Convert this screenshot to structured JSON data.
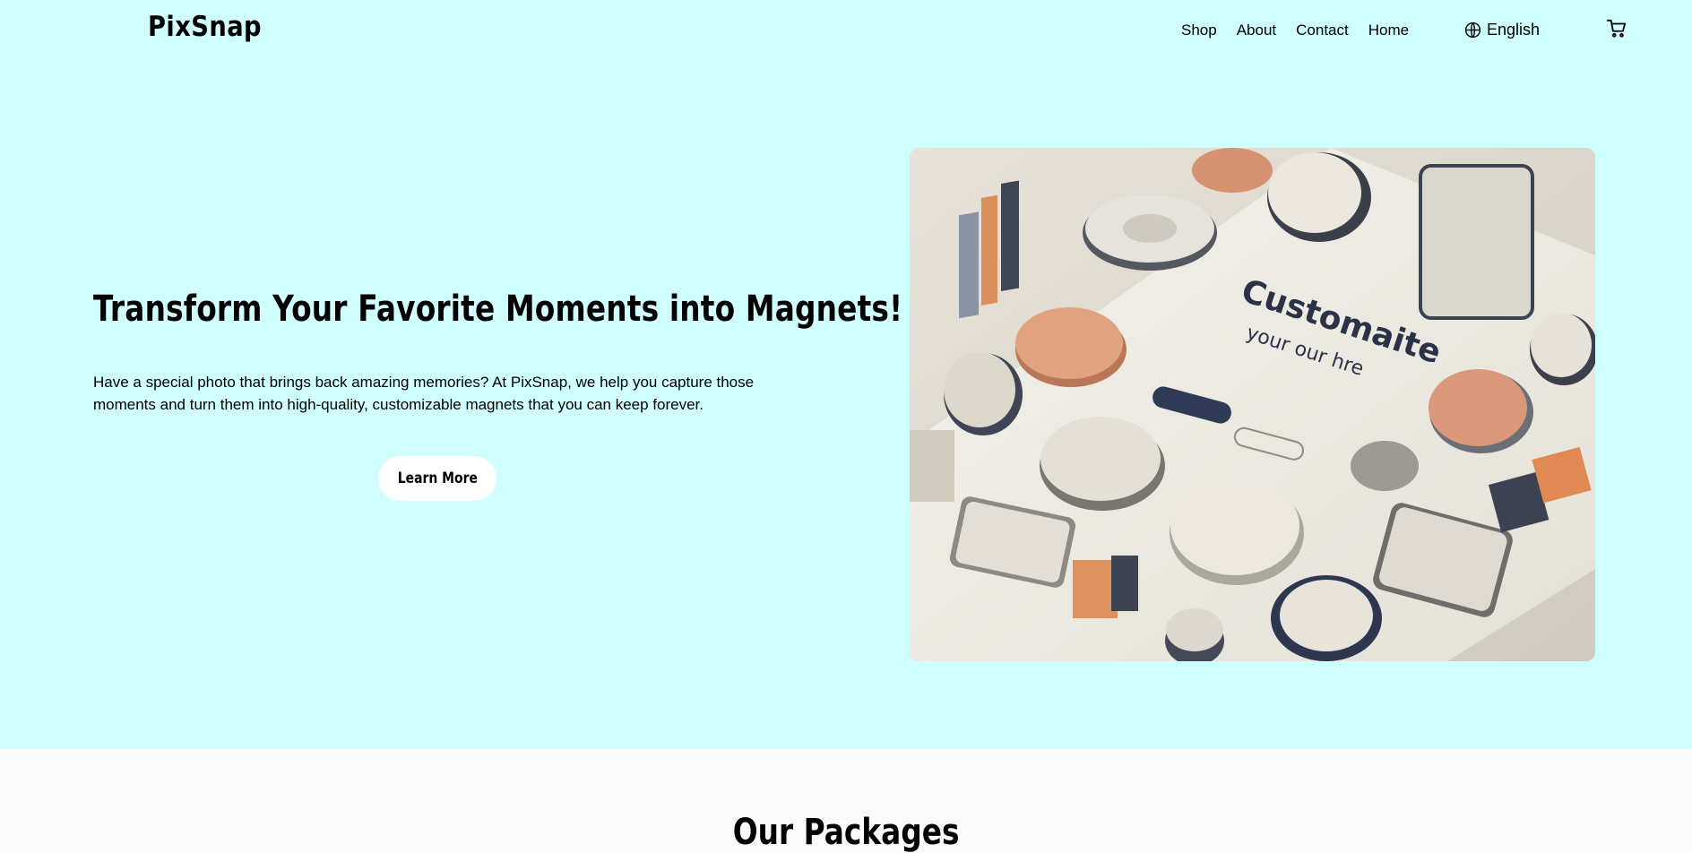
{
  "brand": {
    "name": "PixSnap"
  },
  "nav": {
    "items": [
      {
        "label": "Shop"
      },
      {
        "label": "About"
      },
      {
        "label": "Contact"
      },
      {
        "label": "Home"
      }
    ],
    "language": "English"
  },
  "hero": {
    "title": "Transform Your Favorite Moments into Magnets!",
    "text": "Have a special photo that brings back amazing memories? At PixSnap, we help you capture those moments and turn them into high-quality, customizable magnets that you can keep forever.",
    "cta_label": "Learn More"
  },
  "packages": {
    "title": "Our Packages"
  },
  "colors": {
    "hero_bg": "#cffffe",
    "section_bg": "#fafafa",
    "button_bg": "#ffffff"
  },
  "icons": [
    "globe-icon",
    "cart-icon"
  ]
}
